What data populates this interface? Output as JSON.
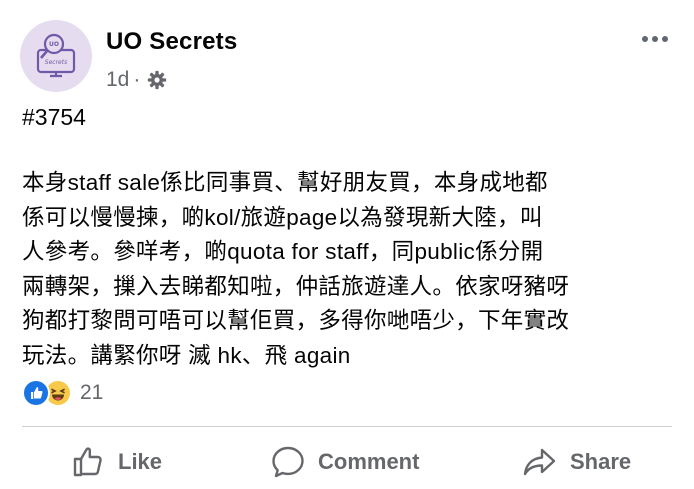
{
  "post": {
    "page_name": "UO Secrets",
    "avatar_text": "UO Secrets",
    "timestamp": "1d",
    "separator": "·",
    "audience_icon": "gear-globe-icon",
    "post_number": "#3754",
    "body_text": "本身staff sale係比同事買、幫好朋友買，本身成地都\n係可以慢慢揀，啲kol/旅遊page以為發現新大陸，叫\n人參考。參咩考，啲quota for staff，同public係分開\n兩轉架，摷入去睇都知啦，仲話旅遊達人。依家呀豬呀\n狗都打黎問可唔可以幫佢買，多得你哋唔少，下年實改\n玩法。講緊你呀  滅  hk、飛 again",
    "reaction_count": "21",
    "reaction_icons": [
      "like-icon",
      "haha-icon"
    ]
  },
  "actions": {
    "like_label": "Like",
    "comment_label": "Comment",
    "share_label": "Share"
  },
  "colors": {
    "text": "#050505",
    "secondary": "#65676b",
    "like_blue": "#1b74e4",
    "haha_yellow": "#f7c94b",
    "avatar_bg": "#e6dcf0",
    "avatar_accent": "#6f5aa8"
  }
}
